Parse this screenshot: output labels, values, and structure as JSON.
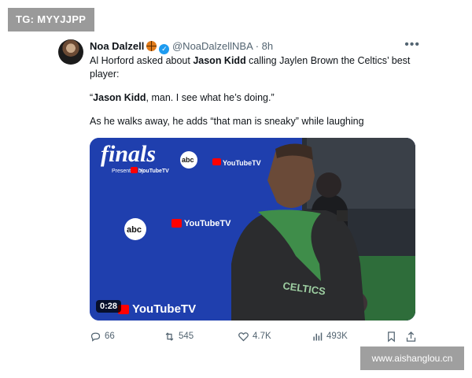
{
  "watermarks": {
    "top": "TG: MYYJJPP",
    "bottom": "www.aishanglou.cn"
  },
  "tweet": {
    "author_name": "Noa Dalzell",
    "handle": "@NoaDalzellNBA",
    "separator": "·",
    "time": "8h",
    "paragraphs": {
      "p1_pre": "Al Horford asked about ",
      "p1_bold": "Jason Kidd",
      "p1_post": " calling Jaylen Brown the Celtics’ best player:",
      "p2_open": "“",
      "p2_bold": "Jason Kidd",
      "p2_post": ", man. I see what he’s doing.”",
      "p3": "As he walks away, he adds “that man is sneaky” while laughing"
    },
    "media": {
      "duration": "0:28",
      "backdrop_text": {
        "finals": "finals",
        "presented_by": "Presented by",
        "youtube_tv": "YouTubeTV",
        "abc": "abc"
      }
    },
    "actions": {
      "replies": "66",
      "reposts": "545",
      "likes": "4.7K",
      "views": "493K"
    }
  },
  "colors": {
    "accent": "#1d9bf0",
    "text": "#0f1419",
    "muted": "#536471",
    "finals_blue": "#1f3fae"
  }
}
